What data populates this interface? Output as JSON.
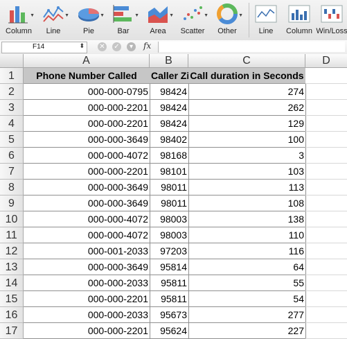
{
  "ribbon": {
    "charts": [
      {
        "label": "Column",
        "icon": "column-chart-icon"
      },
      {
        "label": "Line",
        "icon": "line-chart-icon"
      },
      {
        "label": "Pie",
        "icon": "pie-chart-icon"
      },
      {
        "label": "Bar",
        "icon": "bar-chart-icon"
      },
      {
        "label": "Area",
        "icon": "area-chart-icon"
      },
      {
        "label": "Scatter",
        "icon": "scatter-chart-icon"
      },
      {
        "label": "Other",
        "icon": "other-chart-icon"
      }
    ],
    "sparklines": [
      {
        "label": "Line",
        "icon": "sparkline-line-icon"
      },
      {
        "label": "Column",
        "icon": "sparkline-column-icon"
      },
      {
        "label": "Win/Loss",
        "icon": "sparkline-winloss-icon"
      }
    ]
  },
  "formula_bar": {
    "name_box": "F14",
    "fx_label": "fx",
    "formula": ""
  },
  "columns": [
    "A",
    "B",
    "C",
    "D"
  ],
  "header_row": {
    "row_num": "1",
    "a": "Phone Number Called",
    "b": "Caller Zip",
    "c": "Call duration in Seconds"
  },
  "rows": [
    {
      "n": "2",
      "a": "000-000-0795",
      "b": "98424",
      "c": "274"
    },
    {
      "n": "3",
      "a": "000-000-2201",
      "b": "98424",
      "c": "262"
    },
    {
      "n": "4",
      "a": "000-000-2201",
      "b": "98424",
      "c": "129"
    },
    {
      "n": "5",
      "a": "000-000-3649",
      "b": "98402",
      "c": "100"
    },
    {
      "n": "6",
      "a": "000-000-4072",
      "b": "98168",
      "c": "3"
    },
    {
      "n": "7",
      "a": "000-000-2201",
      "b": "98101",
      "c": "103"
    },
    {
      "n": "8",
      "a": "000-000-3649",
      "b": "98011",
      "c": "113"
    },
    {
      "n": "9",
      "a": "000-000-3649",
      "b": "98011",
      "c": "108"
    },
    {
      "n": "10",
      "a": "000-000-4072",
      "b": "98003",
      "c": "138"
    },
    {
      "n": "11",
      "a": "000-000-4072",
      "b": "98003",
      "c": "110"
    },
    {
      "n": "12",
      "a": "000-001-2033",
      "b": "97203",
      "c": "116"
    },
    {
      "n": "13",
      "a": "000-000-3649",
      "b": "95814",
      "c": "64"
    },
    {
      "n": "14",
      "a": "000-000-2033",
      "b": "95811",
      "c": "55"
    },
    {
      "n": "15",
      "a": "000-000-2201",
      "b": "95811",
      "c": "54"
    },
    {
      "n": "16",
      "a": "000-000-2033",
      "b": "95673",
      "c": "277"
    },
    {
      "n": "17",
      "a": "000-000-2201",
      "b": "95624",
      "c": "227"
    }
  ]
}
